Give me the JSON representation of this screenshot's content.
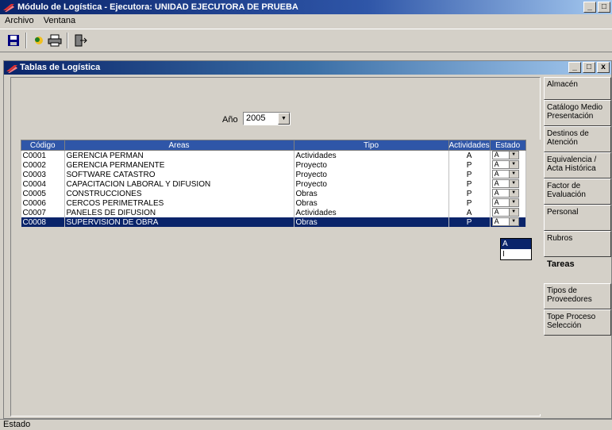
{
  "window": {
    "title": "Módulo de Logística - Ejecutora: UNIDAD EJECUTORA DE PRUEBA",
    "buttons": [
      "_",
      "□"
    ]
  },
  "menu": {
    "items": [
      "Archivo",
      "Ventana"
    ]
  },
  "child": {
    "title": "Tablas de Logística",
    "buttons": [
      "_",
      "□",
      "x"
    ]
  },
  "filter": {
    "year_label": "Año",
    "year_value": "2005"
  },
  "table": {
    "headers": [
      "Código",
      "Areas",
      "Tipo",
      "Actividades",
      "Estado"
    ],
    "rows": [
      {
        "codigo": "C0001",
        "area": "GERENCIA PERMAN",
        "tipo": "Actividades",
        "act": "A",
        "estado": "A"
      },
      {
        "codigo": "C0002",
        "area": "GERENCIA PERMANENTE",
        "tipo": "Proyecto",
        "act": "P",
        "estado": "A"
      },
      {
        "codigo": "C0003",
        "area": "SOFTWARE CATASTRO",
        "tipo": "Proyecto",
        "act": "P",
        "estado": "A"
      },
      {
        "codigo": "C0004",
        "area": "CAPACITACION LABORAL Y DIFUSION",
        "tipo": "Proyecto",
        "act": "P",
        "estado": "A"
      },
      {
        "codigo": "C0005",
        "area": "CONSTRUCCIONES",
        "tipo": "Obras",
        "act": "P",
        "estado": "A"
      },
      {
        "codigo": "C0006",
        "area": "CERCOS PERIMETRALES",
        "tipo": "Obras",
        "act": "P",
        "estado": "A"
      },
      {
        "codigo": "C0007",
        "area": "PANELES DE DIFUSION",
        "tipo": "Actividades",
        "act": "A",
        "estado": "A"
      },
      {
        "codigo": "C0008",
        "area": "SUPERVISION DE OBRA",
        "tipo": "Obras",
        "act": "P",
        "estado": "A"
      }
    ],
    "dropdown_options": [
      "A",
      "I"
    ]
  },
  "nav": {
    "items": [
      "Almacén",
      "Catálogo Medio Presentación",
      "Destinos de Atención",
      "Equivalencia / Acta Histórica",
      "Factor de Evaluación",
      "Personal",
      "Rubros",
      "Tareas",
      "Tipos de Proveedores",
      "Tope Proceso Selección"
    ],
    "active": "Tareas"
  },
  "status": {
    "text": "Estado"
  },
  "colors": {
    "titlebar": "#0a246a",
    "selection": "#0a246a",
    "face": "#d4d0c8"
  }
}
